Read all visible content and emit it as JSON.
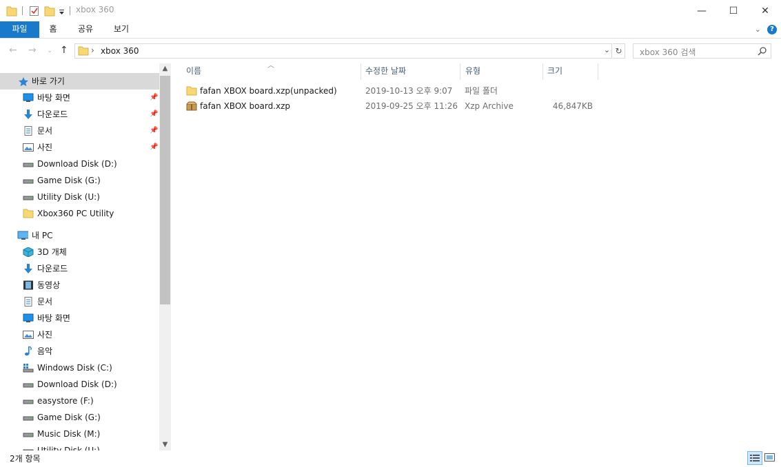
{
  "window": {
    "title": "xbox 360",
    "minimize_glyph": "—",
    "maximize_glyph": "☐",
    "close_glyph": "✕"
  },
  "ribbon": {
    "tabs": [
      "파일",
      "홈",
      "공유",
      "보기"
    ],
    "help_glyph": "?"
  },
  "address": {
    "path_segment": "xbox 360",
    "separator": "›"
  },
  "search": {
    "placeholder": "xbox 360 검색"
  },
  "nav": {
    "quick_access": {
      "label": "바로 가기",
      "items": [
        {
          "label": "바탕 화면",
          "icon": "desktop-icon",
          "pinned": true
        },
        {
          "label": "다운로드",
          "icon": "download-icon",
          "pinned": true
        },
        {
          "label": "문서",
          "icon": "document-icon",
          "pinned": true
        },
        {
          "label": "사진",
          "icon": "pictures-icon",
          "pinned": true
        },
        {
          "label": "Download Disk (D:)",
          "icon": "drive-icon",
          "pinned": false
        },
        {
          "label": "Game Disk (G:)",
          "icon": "drive-icon",
          "pinned": false
        },
        {
          "label": "Utility Disk (U:)",
          "icon": "drive-icon",
          "pinned": false
        },
        {
          "label": "Xbox360 PC Utility",
          "icon": "folder-icon",
          "pinned": false
        }
      ]
    },
    "this_pc": {
      "label": "내 PC",
      "items": [
        {
          "label": "3D 개체",
          "icon": "3d-objects-icon"
        },
        {
          "label": "다운로드",
          "icon": "download-icon"
        },
        {
          "label": "동영상",
          "icon": "video-icon"
        },
        {
          "label": "문서",
          "icon": "document-icon"
        },
        {
          "label": "바탕 화면",
          "icon": "desktop-icon"
        },
        {
          "label": "사진",
          "icon": "pictures-icon"
        },
        {
          "label": "음악",
          "icon": "music-icon"
        },
        {
          "label": "Windows Disk (C:)",
          "icon": "windows-drive-icon"
        },
        {
          "label": "Download Disk (D:)",
          "icon": "drive-icon"
        },
        {
          "label": "easystore (F:)",
          "icon": "drive-icon"
        },
        {
          "label": "Game Disk (G:)",
          "icon": "drive-icon"
        },
        {
          "label": "Music Disk (M:)",
          "icon": "drive-icon"
        },
        {
          "label": "Utility Disk (U:)",
          "icon": "drive-icon"
        }
      ]
    }
  },
  "file_list": {
    "columns": [
      "이름",
      "수정한 날짜",
      "유형",
      "크기"
    ],
    "rows": [
      {
        "name": "fafan XBOX board.xzp(unpacked)",
        "modified": "2019-10-13 오후 9:07",
        "type": "파일 폴더",
        "size": "",
        "icon": "folder-icon"
      },
      {
        "name": "fafan XBOX board.xzp",
        "modified": "2019-09-25 오후 11:26",
        "type": "Xzp Archive",
        "size": "46,847KB",
        "icon": "archive-icon"
      }
    ]
  },
  "status": {
    "item_count": "2개 항목"
  },
  "colors": {
    "accent": "#1979ca",
    "selected_nav": "#d9d9d9",
    "header_text": "#4c607a"
  }
}
